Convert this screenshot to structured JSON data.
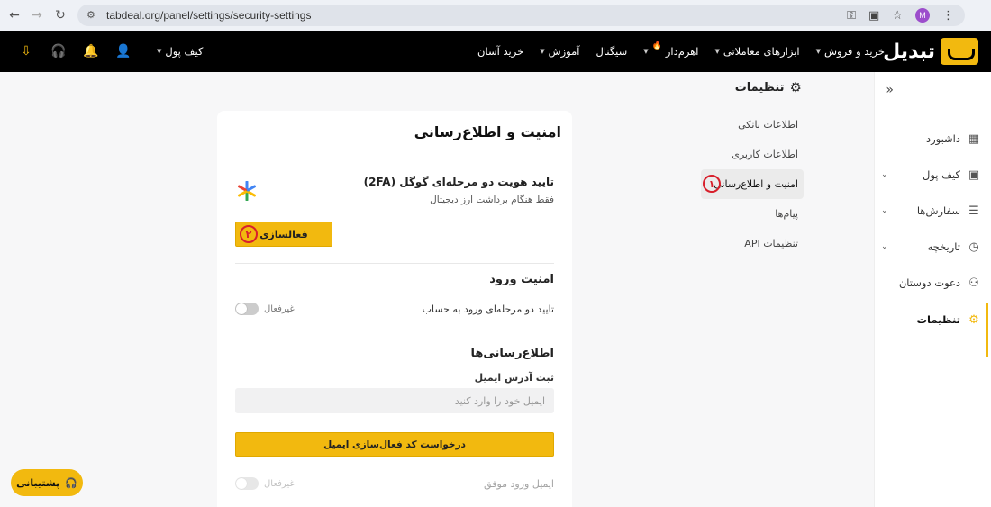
{
  "browser": {
    "url": "tabdeal.org/panel/settings/security-settings",
    "profile_initial": "M"
  },
  "header": {
    "logo_text": "تبدیل",
    "nav": [
      {
        "label": "خرید و فروش",
        "has_menu": true
      },
      {
        "label": "ابزارهای معاملاتی",
        "has_menu": true
      },
      {
        "label": "اهرم‌دار",
        "has_menu": true,
        "hot": true
      },
      {
        "label": "سیگنال",
        "has_menu": false
      },
      {
        "label": "آموزش",
        "has_menu": true
      },
      {
        "label": "خرید آسان",
        "has_menu": false
      }
    ],
    "wallet_label": "کیف پول"
  },
  "sidebar": {
    "items": [
      {
        "label": "داشبورد",
        "icon": "dashboard-icon",
        "has_menu": false
      },
      {
        "label": "کیف پول",
        "icon": "wallet-icon",
        "has_menu": true
      },
      {
        "label": "سفارش‌ها",
        "icon": "orders-icon",
        "has_menu": true
      },
      {
        "label": "تاریخچه",
        "icon": "history-icon",
        "has_menu": true
      },
      {
        "label": "دعوت دوستان",
        "icon": "invite-icon",
        "has_menu": false
      },
      {
        "label": "تنظیمات",
        "icon": "gear-icon",
        "has_menu": false,
        "active": true
      }
    ]
  },
  "settings": {
    "title": "تنظیمات",
    "menu": [
      {
        "label": "اطلاعات بانکی"
      },
      {
        "label": "اطلاعات کاربری"
      },
      {
        "label": "امنیت و اطلاع‌رسانی",
        "active": true,
        "marker": "۱"
      },
      {
        "label": "پیام‌ها"
      },
      {
        "label": "تنظیمات API"
      }
    ]
  },
  "card": {
    "title": "امنیت و اطلاع‌رسانی",
    "twofa": {
      "title": "تایید هویت دو مرحله‌ای گوگل (2FA)",
      "subtitle": "فقط هنگام برداشت ارز دیجیتال",
      "button_label": "فعالسازی",
      "marker": "۲"
    },
    "login_security": {
      "title": "امنیت ورود",
      "row_label": "تایید دو مرحله‌ای ورود به حساب",
      "toggle_state": "غیرفعال"
    },
    "notifications": {
      "title": "اطلاع‌رسانی‌ها",
      "email_label": "ثبت آدرس ایمیل",
      "email_placeholder": "ایمیل خود را وارد کنید",
      "email_value": "",
      "request_button": "درخواست کد فعال‌سازی ایمیل",
      "success_row_label": "ایمیل ورود موفق",
      "success_toggle_state": "غیرفعال"
    }
  },
  "support": {
    "label": "پشتیبانی"
  },
  "colors": {
    "accent": "#f2b90f",
    "marker": "#d8202c"
  }
}
